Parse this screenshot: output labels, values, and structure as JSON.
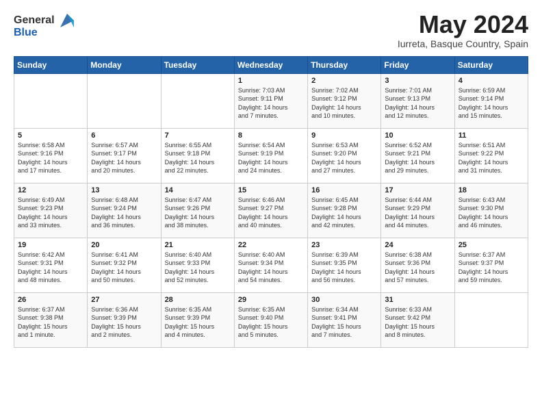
{
  "header": {
    "logo_general": "General",
    "logo_blue": "Blue",
    "month_title": "May 2024",
    "subtitle": "Iurreta, Basque Country, Spain"
  },
  "weekdays": [
    "Sunday",
    "Monday",
    "Tuesday",
    "Wednesday",
    "Thursday",
    "Friday",
    "Saturday"
  ],
  "weeks": [
    [
      {
        "day": "",
        "content": ""
      },
      {
        "day": "",
        "content": ""
      },
      {
        "day": "",
        "content": ""
      },
      {
        "day": "1",
        "content": "Sunrise: 7:03 AM\nSunset: 9:11 PM\nDaylight: 14 hours\nand 7 minutes."
      },
      {
        "day": "2",
        "content": "Sunrise: 7:02 AM\nSunset: 9:12 PM\nDaylight: 14 hours\nand 10 minutes."
      },
      {
        "day": "3",
        "content": "Sunrise: 7:01 AM\nSunset: 9:13 PM\nDaylight: 14 hours\nand 12 minutes."
      },
      {
        "day": "4",
        "content": "Sunrise: 6:59 AM\nSunset: 9:14 PM\nDaylight: 14 hours\nand 15 minutes."
      }
    ],
    [
      {
        "day": "5",
        "content": "Sunrise: 6:58 AM\nSunset: 9:16 PM\nDaylight: 14 hours\nand 17 minutes."
      },
      {
        "day": "6",
        "content": "Sunrise: 6:57 AM\nSunset: 9:17 PM\nDaylight: 14 hours\nand 20 minutes."
      },
      {
        "day": "7",
        "content": "Sunrise: 6:55 AM\nSunset: 9:18 PM\nDaylight: 14 hours\nand 22 minutes."
      },
      {
        "day": "8",
        "content": "Sunrise: 6:54 AM\nSunset: 9:19 PM\nDaylight: 14 hours\nand 24 minutes."
      },
      {
        "day": "9",
        "content": "Sunrise: 6:53 AM\nSunset: 9:20 PM\nDaylight: 14 hours\nand 27 minutes."
      },
      {
        "day": "10",
        "content": "Sunrise: 6:52 AM\nSunset: 9:21 PM\nDaylight: 14 hours\nand 29 minutes."
      },
      {
        "day": "11",
        "content": "Sunrise: 6:51 AM\nSunset: 9:22 PM\nDaylight: 14 hours\nand 31 minutes."
      }
    ],
    [
      {
        "day": "12",
        "content": "Sunrise: 6:49 AM\nSunset: 9:23 PM\nDaylight: 14 hours\nand 33 minutes."
      },
      {
        "day": "13",
        "content": "Sunrise: 6:48 AM\nSunset: 9:24 PM\nDaylight: 14 hours\nand 36 minutes."
      },
      {
        "day": "14",
        "content": "Sunrise: 6:47 AM\nSunset: 9:26 PM\nDaylight: 14 hours\nand 38 minutes."
      },
      {
        "day": "15",
        "content": "Sunrise: 6:46 AM\nSunset: 9:27 PM\nDaylight: 14 hours\nand 40 minutes."
      },
      {
        "day": "16",
        "content": "Sunrise: 6:45 AM\nSunset: 9:28 PM\nDaylight: 14 hours\nand 42 minutes."
      },
      {
        "day": "17",
        "content": "Sunrise: 6:44 AM\nSunset: 9:29 PM\nDaylight: 14 hours\nand 44 minutes."
      },
      {
        "day": "18",
        "content": "Sunrise: 6:43 AM\nSunset: 9:30 PM\nDaylight: 14 hours\nand 46 minutes."
      }
    ],
    [
      {
        "day": "19",
        "content": "Sunrise: 6:42 AM\nSunset: 9:31 PM\nDaylight: 14 hours\nand 48 minutes."
      },
      {
        "day": "20",
        "content": "Sunrise: 6:41 AM\nSunset: 9:32 PM\nDaylight: 14 hours\nand 50 minutes."
      },
      {
        "day": "21",
        "content": "Sunrise: 6:40 AM\nSunset: 9:33 PM\nDaylight: 14 hours\nand 52 minutes."
      },
      {
        "day": "22",
        "content": "Sunrise: 6:40 AM\nSunset: 9:34 PM\nDaylight: 14 hours\nand 54 minutes."
      },
      {
        "day": "23",
        "content": "Sunrise: 6:39 AM\nSunset: 9:35 PM\nDaylight: 14 hours\nand 56 minutes."
      },
      {
        "day": "24",
        "content": "Sunrise: 6:38 AM\nSunset: 9:36 PM\nDaylight: 14 hours\nand 57 minutes."
      },
      {
        "day": "25",
        "content": "Sunrise: 6:37 AM\nSunset: 9:37 PM\nDaylight: 14 hours\nand 59 minutes."
      }
    ],
    [
      {
        "day": "26",
        "content": "Sunrise: 6:37 AM\nSunset: 9:38 PM\nDaylight: 15 hours\nand 1 minute."
      },
      {
        "day": "27",
        "content": "Sunrise: 6:36 AM\nSunset: 9:39 PM\nDaylight: 15 hours\nand 2 minutes."
      },
      {
        "day": "28",
        "content": "Sunrise: 6:35 AM\nSunset: 9:39 PM\nDaylight: 15 hours\nand 4 minutes."
      },
      {
        "day": "29",
        "content": "Sunrise: 6:35 AM\nSunset: 9:40 PM\nDaylight: 15 hours\nand 5 minutes."
      },
      {
        "day": "30",
        "content": "Sunrise: 6:34 AM\nSunset: 9:41 PM\nDaylight: 15 hours\nand 7 minutes."
      },
      {
        "day": "31",
        "content": "Sunrise: 6:33 AM\nSunset: 9:42 PM\nDaylight: 15 hours\nand 8 minutes."
      },
      {
        "day": "",
        "content": ""
      }
    ]
  ]
}
